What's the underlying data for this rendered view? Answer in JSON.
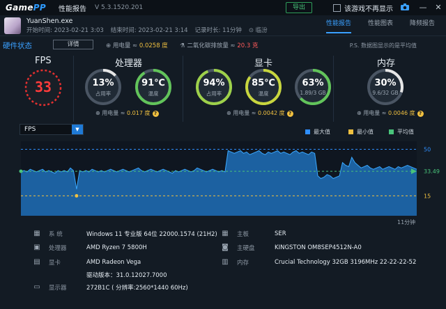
{
  "titlebar": {
    "logo_a": "Game",
    "logo_b": "PP",
    "title": "性能报告",
    "version": "V 5.3.1520.201",
    "export_label": "导出",
    "no_show_label": "该游戏不再显示"
  },
  "header": {
    "exe": "YuanShen.exe",
    "start": "开始时间: 2023-02-21 3:03",
    "end": "结束时间: 2023-02-21 3:14",
    "duration": "记录时长: 11分钟",
    "location": "临汾",
    "tabs": [
      "性能报告",
      "性能图表",
      "降频报告"
    ]
  },
  "hardware": {
    "title": "硬件状态",
    "details_label": "详情",
    "power": "用电量 ≈ ",
    "power_value": "0.0258 度",
    "co2": "二氧化碳排放量 ≈ ",
    "co2_value": "20.3 克",
    "note": "P.S. 数据图显示的是平均值"
  },
  "sections": {
    "fps": "FPS",
    "cpu": "处理器",
    "gpu": "显卡",
    "mem": "内存"
  },
  "gauges": {
    "fps_value": "33",
    "cpu_usage": "13%",
    "cpu_usage_label": "占用率",
    "cpu_usage_frac": 0.13,
    "cpu_temp": "91℃",
    "cpu_temp_label": "温度",
    "cpu_temp_frac": 0.91,
    "gpu_usage": "94%",
    "gpu_usage_label": "占用率",
    "gpu_usage_frac": 0.94,
    "gpu_temp": "85℃",
    "gpu_temp_label": "温度",
    "gpu_temp_frac": 0.85,
    "gpu_mem": "63%",
    "gpu_mem_label": "1.89/3 GB",
    "gpu_mem_frac": 0.63,
    "mem_usage": "30%",
    "mem_usage_label": "9.6/32 GB",
    "mem_usage_frac": 0.3
  },
  "sub_power": {
    "prefix": "用电量 ≈ ",
    "cpu": "0.017 度",
    "gpu": "0.0042 度",
    "mem": "0.0046 度"
  },
  "chart": {
    "select_value": "FPS",
    "legend": [
      "最大值",
      "最小值",
      "平均值"
    ],
    "colors": {
      "max": "#2f8fff",
      "min": "#f0c040",
      "avg": "#49c47b",
      "fill": "#1f6fb8"
    }
  },
  "chart_data": {
    "type": "area",
    "title": "",
    "xlabel": "11分钟",
    "ylabel": "",
    "ylim": [
      0,
      55
    ],
    "max": 50,
    "min": 15,
    "avg": 33.49,
    "tick_labels": [
      "50",
      "33.49",
      "15"
    ],
    "x_end_label": "11分钟",
    "values": [
      33,
      34,
      33,
      35,
      34,
      33,
      34,
      35,
      33,
      34,
      33,
      32,
      34,
      33,
      34,
      33,
      36,
      34,
      20,
      34,
      33,
      34,
      33,
      35,
      34,
      33,
      34,
      33,
      34,
      35,
      34,
      33,
      34,
      35,
      34,
      33,
      34,
      35,
      36,
      34,
      33,
      34,
      35,
      34,
      33,
      34,
      35,
      34,
      33,
      32,
      34,
      33,
      34,
      35,
      34,
      33,
      34,
      36,
      35,
      34,
      33,
      34,
      35,
      34,
      33,
      34,
      33,
      49,
      48,
      47,
      48,
      49,
      47,
      48,
      46,
      47,
      48,
      49,
      47,
      46,
      48,
      47,
      48,
      49,
      47,
      48,
      47,
      46,
      48,
      49,
      47,
      48,
      47,
      46,
      48,
      47,
      30,
      28,
      29,
      31,
      30,
      28,
      29,
      30,
      40,
      38,
      37,
      44,
      40,
      38,
      36,
      37,
      38,
      36,
      35,
      36,
      37,
      35,
      36,
      37,
      36,
      35,
      37,
      36,
      37,
      38,
      37,
      36,
      35
    ]
  },
  "info": {
    "left": [
      {
        "key": "系  统",
        "value": "Windows 11 专业版 64位 22000.1574 (21H2)"
      },
      {
        "key": "处理器",
        "value": "AMD Ryzen 7 5800H"
      },
      {
        "key": "显卡",
        "value": "AMD Radeon Vega"
      },
      {
        "key": "",
        "value": "驱动版本：31.0.12027.7000"
      },
      {
        "key": "显示器",
        "value": "272B1C ( 分辨率:2560*1440 60Hz)"
      }
    ],
    "right": [
      {
        "key": "主板",
        "value": "SER"
      },
      {
        "key": "主硬盘",
        "value": "KINGSTON OM8SEP4512N-A0"
      },
      {
        "key": "内存",
        "value": "Crucial Technology 32GB 3196MHz 22-22-22-52"
      }
    ]
  }
}
